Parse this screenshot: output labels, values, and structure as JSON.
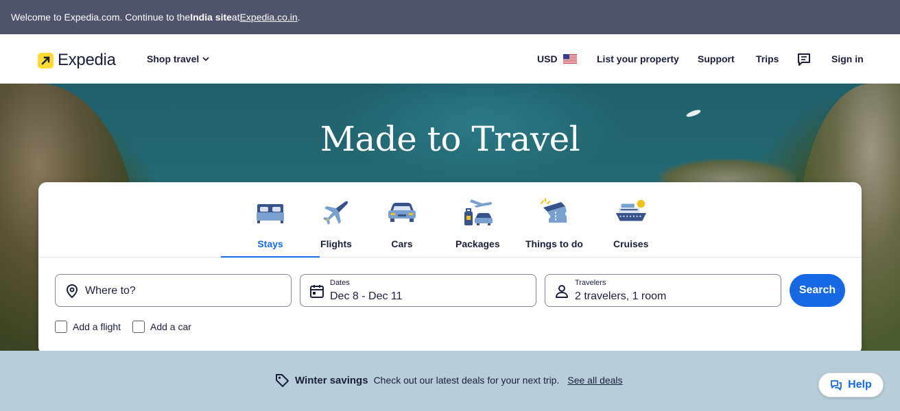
{
  "banner": {
    "text_before": "Welcome to Expedia.com. Continue to the ",
    "text_bold": "India site",
    "text_middle": " at ",
    "link": "Expedia.co.in",
    "text_after": "."
  },
  "header": {
    "brand": "Expedia",
    "shop_travel": "Shop travel",
    "currency": "USD",
    "list_property": "List your property",
    "support": "Support",
    "trips": "Trips",
    "sign_in": "Sign in"
  },
  "hero": {
    "title": "Made to Travel"
  },
  "tabs": [
    {
      "label": "Stays",
      "icon": "bed-icon",
      "active": true
    },
    {
      "label": "Flights",
      "icon": "airplane-icon"
    },
    {
      "label": "Cars",
      "icon": "car-icon"
    },
    {
      "label": "Packages",
      "icon": "package-icon"
    },
    {
      "label": "Things to do",
      "icon": "ticket-icon"
    },
    {
      "label": "Cruises",
      "icon": "cruise-ship-icon"
    }
  ],
  "search": {
    "destination_placeholder": "Where to?",
    "dates_label": "Dates",
    "dates_value": "Dec 8 - Dec 11",
    "travelers_label": "Travelers",
    "travelers_value": "2 travelers, 1 room",
    "button": "Search"
  },
  "options": {
    "add_flight": "Add a flight",
    "add_car": "Add a car"
  },
  "promo": {
    "title": "Winter savings",
    "text": "Check out our latest deals for your next trip.",
    "link": "See all deals"
  },
  "help": {
    "label": "Help"
  },
  "colors": {
    "accent": "#1668e3",
    "banner": "#4f536b",
    "brand_yellow": "#fddb32",
    "promo_bg": "#b8cdda"
  }
}
